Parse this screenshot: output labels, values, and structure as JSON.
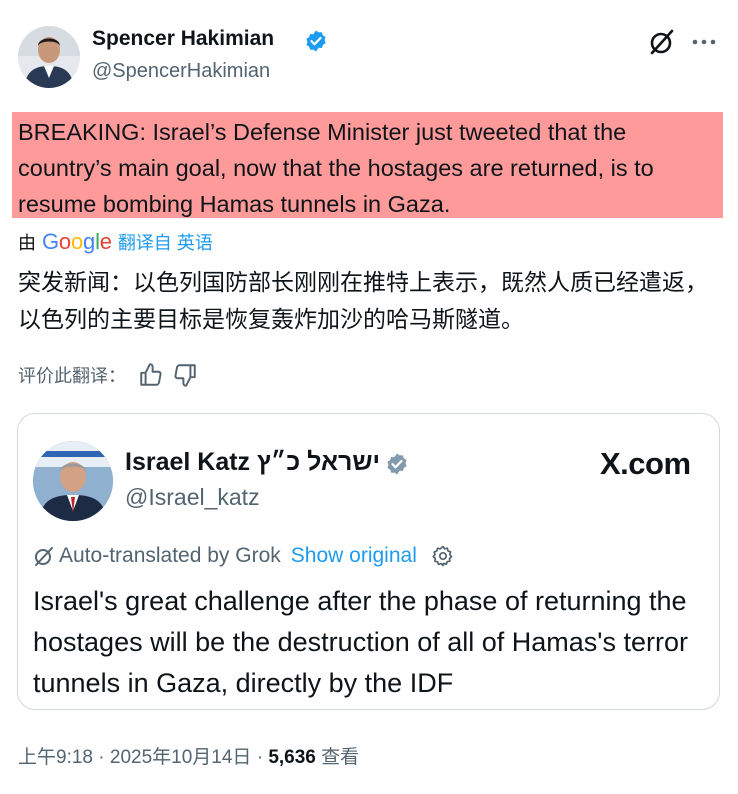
{
  "author": {
    "name": "Spencer Hakimian",
    "handle": "@SpencerHakimian",
    "verified": true
  },
  "tweet": {
    "text": "BREAKING: Israel’s Defense Minister just tweeted that the country’s main goal, now that the hostages are returned, is to resume bombing Hamas tunnels in Gaza.",
    "highlight_color": "#fe9a9a"
  },
  "translation": {
    "by_prefix": "由",
    "provider_letters": [
      "G",
      "o",
      "o",
      "g",
      "l",
      "e"
    ],
    "link_label": "翻译自 英语",
    "text": "突发新闻：以色列国防部长刚刚在推特上表示，既然人质已经遣返，以色列的主要目标是恢复轰炸加沙的哈马斯隧道。",
    "rate_label": "评价此翻译："
  },
  "quote": {
    "name": "Israel Katz ישראל כ״ץ",
    "handle": "@Israel_katz",
    "source": "X.com",
    "auto_translated_label": "Auto-translated by Grok",
    "show_original_label": "Show original",
    "text": "Israel's great challenge after the phase of returning the hostages will be the destruction of all of Hamas's terror tunnels in Gaza, directly by the IDF"
  },
  "meta": {
    "time": "上午9:18",
    "separator": "·",
    "date": "2025年10月14日",
    "views": "5,636",
    "views_label": "查看"
  },
  "colors": {
    "accent": "#1d9bf0",
    "secondary_text": "#536471",
    "border": "#cfd9de"
  },
  "icons": [
    "grok-icon",
    "more-icon",
    "verified-badge-icon",
    "thumbs-up-icon",
    "thumbs-down-icon",
    "gear-icon"
  ]
}
